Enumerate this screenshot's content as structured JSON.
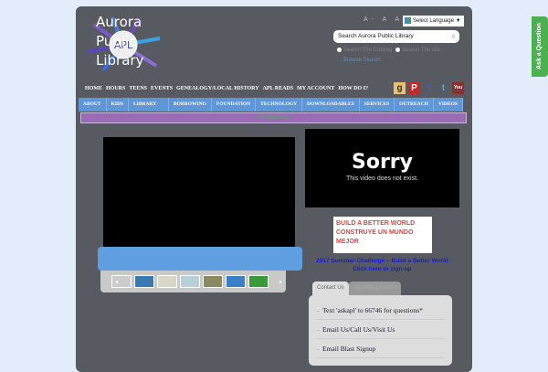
{
  "brand": {
    "line1": "Aurora",
    "line2": "Public",
    "line3": "Library",
    "logo_text": "APL"
  },
  "font_size": "A- A A+",
  "language": "Select Language ▼",
  "search": {
    "placeholder": "Search Aurora Public Library",
    "icon": "search-icon",
    "opt1": "Search The Catalog",
    "opt2": "Search The site",
    "browse": "Browse Search"
  },
  "topnav": [
    "HOME",
    "HOURS",
    "TEENS",
    "EVENTS",
    "GENEALOGY/LOCAL HISTORY",
    "APL READS",
    "MY ACCOUNT",
    "HOW DO I?"
  ],
  "social": [
    "g",
    "P",
    "f",
    "t",
    "You"
  ],
  "mainnav": [
    "ABOUT",
    "KIDS",
    "LIBRARY CARDS",
    "BORROWING",
    "FOUNDATION",
    "TECHNOLOGY",
    "DOWNLOADABLES",
    "SERVICES",
    "OUTREACH",
    "VIDEOS"
  ],
  "news": "Library News",
  "video": {
    "title": "Sorry",
    "message": "This video does not exist."
  },
  "promo": {
    "image_text": "BUILD A BETTER WORLD CONSTRUYE UN MUNDO MEJOR",
    "line1": "2017 Summer Challenge – Build a Better World",
    "line2": "Click here to sign-up"
  },
  "tabs": [
    "Contact Us",
    "Upcoming Events"
  ],
  "contact": [
    "Text 'askapl' to 66746 for questions*",
    "Email Us/Call Us/Visit Us",
    "Email Blast Signup"
  ],
  "ask": "Ask a Question",
  "colors": {
    "nav": "#5e96d6",
    "news": "#9a6cb6",
    "ask": "#4caf50"
  }
}
